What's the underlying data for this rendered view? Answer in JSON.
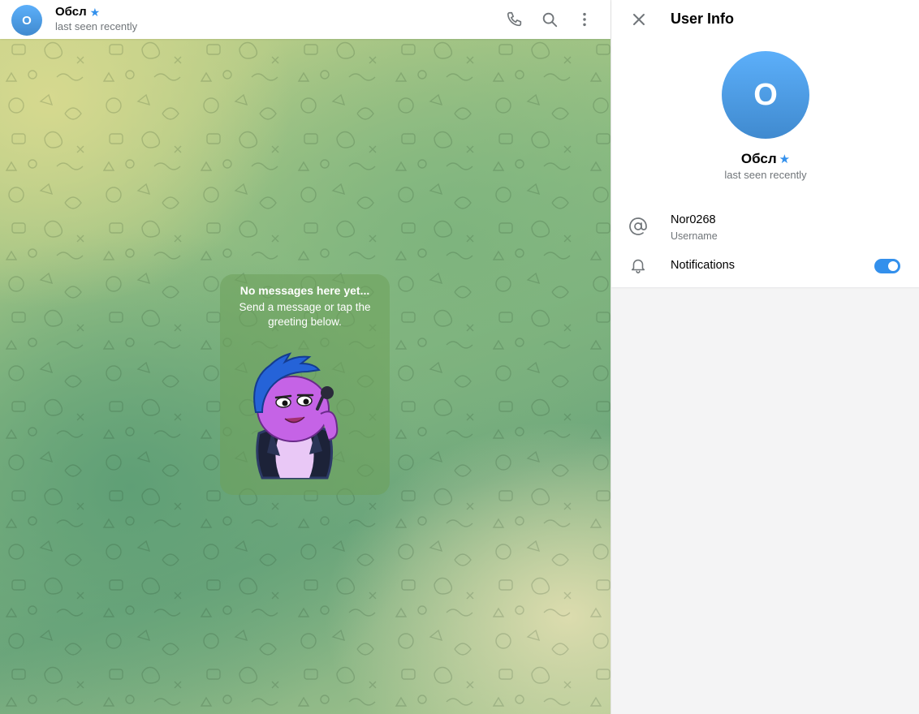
{
  "chat": {
    "peer_initial": "О",
    "peer_name": "Обсл",
    "peer_status": "last seen recently",
    "header_icons": [
      "phone-icon",
      "search-icon",
      "more-vertical-icon"
    ],
    "empty_title": "No messages here yet...",
    "empty_subtitle": "Send a message or tap the greeting below."
  },
  "panel": {
    "title": "User Info",
    "avatar_initial": "О",
    "name": "Обсл",
    "status": "last seen recently",
    "username_value": "Nor0268",
    "username_label": "Username",
    "notifications_label": "Notifications",
    "notifications_enabled": true
  },
  "colors": {
    "accent": "#3390ec",
    "avatar_top": "#5caffa",
    "avatar_bottom": "#408acf",
    "secondary_text": "#707579"
  }
}
